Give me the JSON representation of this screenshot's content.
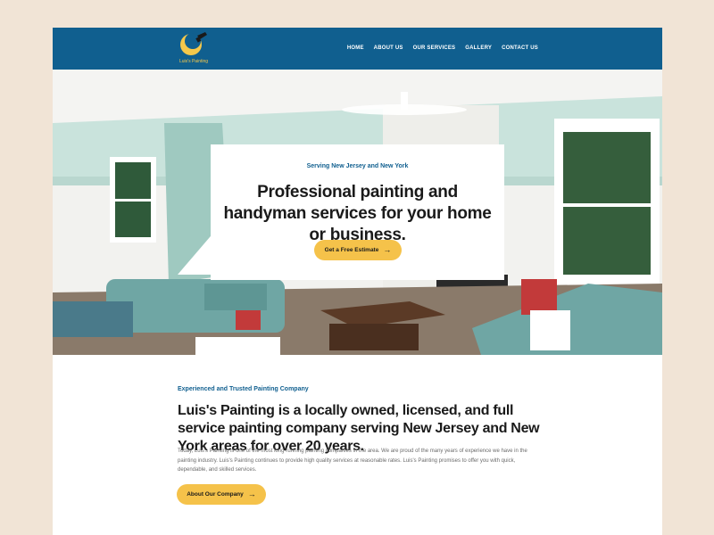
{
  "brand": {
    "name": "Luis's Painting",
    "logo_colors": {
      "circle": "#f5c84b",
      "brush": "#1a1a1a"
    }
  },
  "nav": {
    "items": [
      {
        "label": "HOME"
      },
      {
        "label": "ABOUT US"
      },
      {
        "label": "OUR SERVICES"
      },
      {
        "label": "GALLERY"
      },
      {
        "label": "CONTACT US"
      }
    ]
  },
  "hero": {
    "eyebrow": "Serving New Jersey and New York",
    "title": "Professional painting and handyman services for your home or business.",
    "cta_label": "Get a Free Estimate",
    "cta_icon": "arrow-right-icon"
  },
  "about": {
    "eyebrow": "Experienced and Trusted Painting Company",
    "title": "Luis's Painting is a locally owned, licensed, and full service painting company serving New Jersey and New York areas for over 20 years.",
    "body": "Today, Luis's Painting is one of the most long-running painting companies in the area. We are proud of the many years of experience we have in the painting industry. Luis's Painting continues to provide high quality services at reasonable rates. Luis's Painting promises to offer you with quick, dependable, and skilled services.",
    "cta_label": "About Our Company",
    "cta_icon": "arrow-right-icon"
  },
  "colors": {
    "nav_background": "#105f8f",
    "accent": "#f5c24a",
    "page_background": "#f1e4d6",
    "heading": "#1a1a1a",
    "eyebrow": "#105f8f"
  }
}
